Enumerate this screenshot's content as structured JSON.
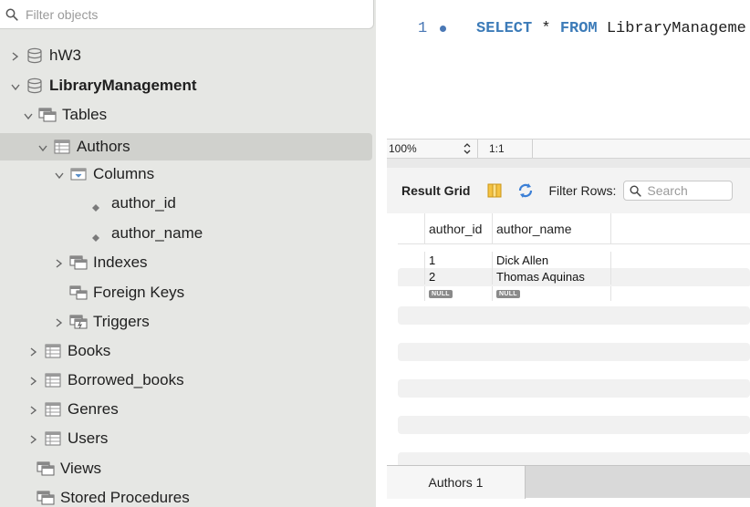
{
  "sidebar": {
    "filter_placeholder": "Filter objects",
    "tree": {
      "schema1": "hW3",
      "schema2": "LibraryManagement",
      "tables": "Tables",
      "authors": "Authors",
      "columns": "Columns",
      "col_author_id": "author_id",
      "col_author_name": "author_name",
      "indexes": "Indexes",
      "foreign_keys": "Foreign Keys",
      "triggers": "Triggers",
      "books": "Books",
      "borrowed_books": "Borrowed_books",
      "genres": "Genres",
      "users": "Users",
      "views": "Views",
      "stored_procedures": "Stored Procedures"
    }
  },
  "editor": {
    "line_number": "1",
    "sql_kw1": "SELECT",
    "sql_star": " * ",
    "sql_kw2": "FROM",
    "sql_rest": " LibraryManageme"
  },
  "status": {
    "zoom": "100%",
    "position": "1:1"
  },
  "results": {
    "label": "Result Grid",
    "filter_label": "Filter Rows:",
    "search_placeholder": "Search",
    "columns": [
      "author_id",
      "author_name"
    ],
    "rows": [
      [
        "1",
        "Dick Allen"
      ],
      [
        "2",
        "Thomas Aquinas"
      ],
      [
        "NULL",
        "NULL"
      ]
    ]
  },
  "tabs": {
    "active": "Authors 1"
  },
  "colors": {
    "sidebar_bg": "#e6e7e4",
    "selected_row": "#d0d1cd",
    "keyword": "#3c7bb8"
  }
}
